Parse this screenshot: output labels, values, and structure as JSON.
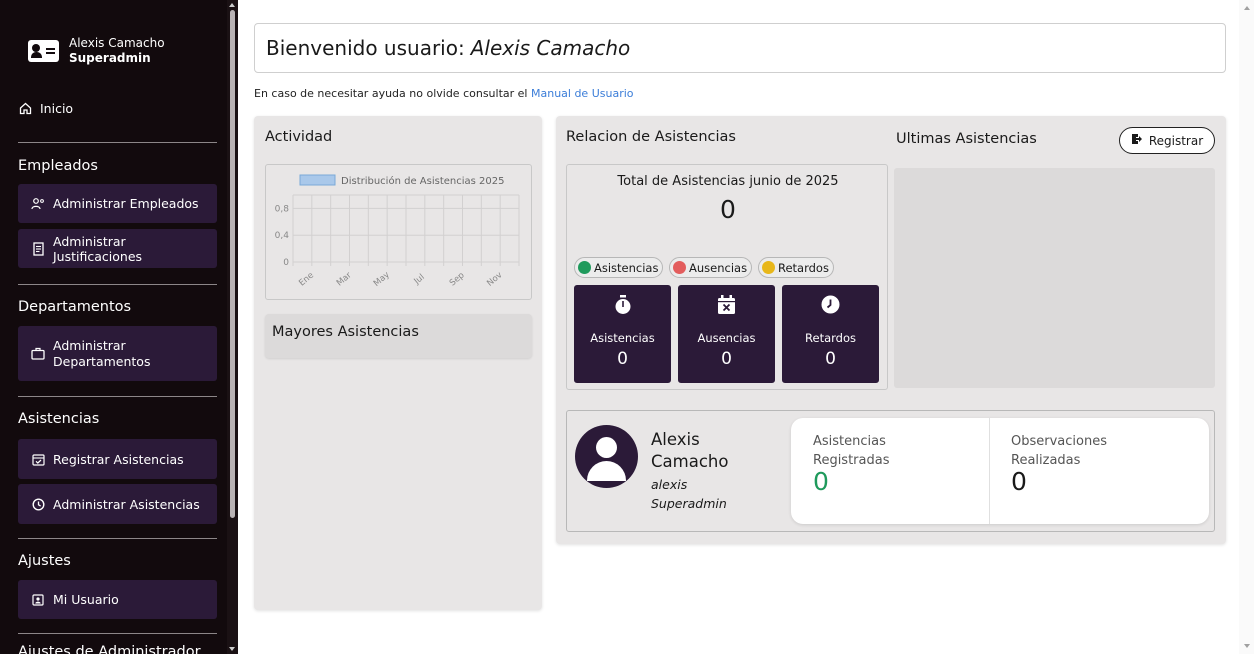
{
  "sidebar": {
    "user_name": "Alexis Camacho",
    "user_role": "Superadmin",
    "home": "Inicio",
    "sections": {
      "empleados": "Empleados",
      "departamentos": "Departamentos",
      "asistencias": "Asistencias",
      "ajustes": "Ajustes",
      "cut_off": "Ajustes de Administrador"
    },
    "items": {
      "admin_empleados": "Administrar Empleados",
      "admin_justificaciones": "Administrar Justificaciones",
      "admin_departamentos_1": "Administrar",
      "admin_departamentos_2": "Departamentos",
      "registrar_asistencias": "Registrar Asistencias",
      "admin_asistencias": "Administrar Asistencias",
      "mi_usuario": "Mi Usuario"
    }
  },
  "header": {
    "welcome_prefix": "Bienvenido usuario:",
    "welcome_name": "Alexis Camacho",
    "help_text": "En caso de necesitar ayuda no olvide consultar el",
    "help_link": "Manual de Usuario"
  },
  "activity": {
    "title": "Actividad",
    "mayores_title": "Mayores Asistencias"
  },
  "chart_data": {
    "type": "bar",
    "categories": [
      "Ene",
      "Mar",
      "May",
      "Jul",
      "Sep",
      "Nov"
    ],
    "series": [
      {
        "name": "Distribución de Asistencias 2025",
        "values": [
          0,
          0,
          0,
          0,
          0,
          0
        ]
      }
    ],
    "y_ticks": [
      "0,8",
      "0,4",
      "0"
    ],
    "ylim": [
      0,
      1
    ],
    "legend_position": "top",
    "grid": true,
    "color": "#a9c8ea"
  },
  "relacion": {
    "title": "Relacion de Asistencias",
    "total_title": "Total de Asistencias junio de 2025",
    "total_value": "0",
    "legend": [
      {
        "label": "Asistencias",
        "color": "#1f9a5c"
      },
      {
        "label": "Ausencias",
        "color": "#e35d5d"
      },
      {
        "label": "Retardos",
        "color": "#e8b71a"
      }
    ],
    "stats": [
      {
        "label": "Asistencias",
        "value": "0",
        "icon": "stopwatch-icon"
      },
      {
        "label": "Ausencias",
        "value": "0",
        "icon": "calendar-x-icon"
      },
      {
        "label": "Retardos",
        "value": "0",
        "icon": "clock-icon"
      }
    ]
  },
  "ultimas": {
    "title": "Ultimas Asistencias",
    "register_button": "Registrar"
  },
  "profile": {
    "name": "Alexis Camacho",
    "username": "alexis",
    "role": "Superadmin",
    "stat1_label": "Asistencias Registradas",
    "stat1_value": "0",
    "stat1_color": "#1f9a5c",
    "stat2_label": "Observaciones Realizadas",
    "stat2_value": "0"
  }
}
